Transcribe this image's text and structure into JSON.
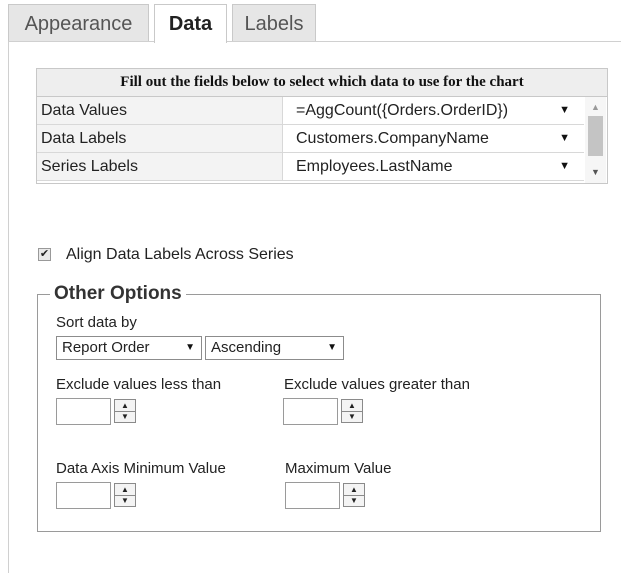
{
  "tabs": [
    {
      "label": "Appearance",
      "active": false
    },
    {
      "label": "Data",
      "active": true
    },
    {
      "label": "Labels",
      "active": false
    }
  ],
  "grid": {
    "header": "Fill out the fields below to select which data to use for the chart",
    "rows": [
      {
        "label": "Data Values",
        "value": "=AggCount({Orders.OrderID})"
      },
      {
        "label": "Data Labels",
        "value": "Customers.CompanyName"
      },
      {
        "label": "Series Labels",
        "value": "Employees.LastName"
      }
    ]
  },
  "align_checkbox": {
    "label": "Align Data Labels Across Series",
    "checked": true
  },
  "other_options": {
    "title": "Other Options",
    "sort_label": "Sort data by",
    "sort_by": {
      "selected": "Report Order"
    },
    "sort_direction": {
      "selected": "Ascending"
    },
    "exclude_less_label": "Exclude values less than",
    "exclude_greater_label": "Exclude values greater than",
    "axis_min_label": "Data Axis Minimum Value",
    "axis_max_label": "Maximum Value"
  },
  "icons": {
    "dropdown": "caret-down-icon",
    "spin_up": "spin-up-icon",
    "spin_down": "spin-down-icon",
    "check": "checkmark-icon"
  }
}
